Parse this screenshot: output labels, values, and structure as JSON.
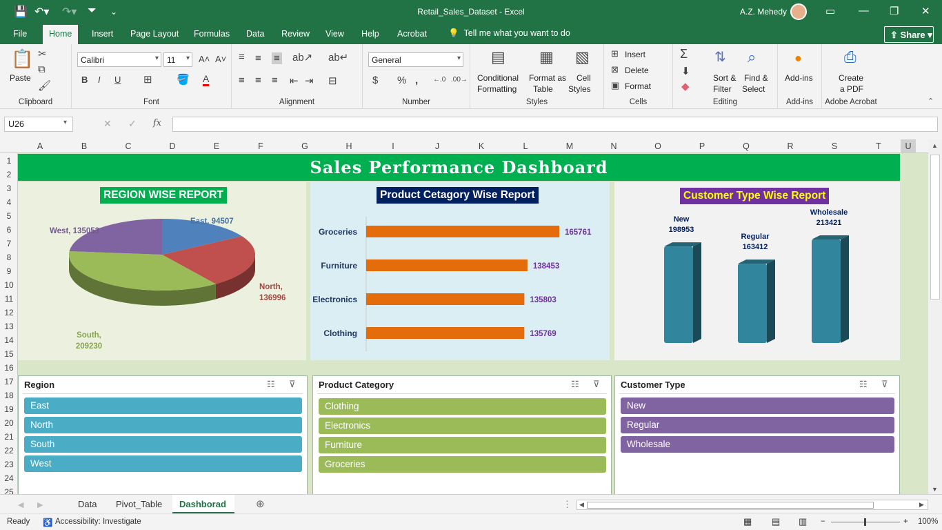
{
  "window": {
    "title": "Retail_Sales_Dataset  -  Excel",
    "user": "A.Z. Mehedy"
  },
  "menu": {
    "tabs": [
      "File",
      "Home",
      "Insert",
      "Page Layout",
      "Formulas",
      "Data",
      "Review",
      "View",
      "Help",
      "Acrobat"
    ],
    "active": "Home",
    "tell_me": "Tell me what you want to do",
    "share": "Share"
  },
  "ribbon": {
    "clipboard": {
      "label": "Clipboard",
      "paste": "Paste"
    },
    "font": {
      "label": "Font",
      "name": "Calibri",
      "size": "11"
    },
    "alignment": {
      "label": "Alignment"
    },
    "number": {
      "label": "Number",
      "format": "General"
    },
    "styles": {
      "label": "Styles",
      "conditional": "Conditional",
      "conditional2": "Formatting",
      "format_table": "Format as",
      "format_table2": "Table",
      "cell_styles": "Cell",
      "cell_styles2": "Styles"
    },
    "cells": {
      "label": "Cells",
      "insert": "Insert",
      "delete": "Delete",
      "format": "Format"
    },
    "editing": {
      "label": "Editing",
      "sort": "Sort &",
      "sort2": "Filter",
      "find": "Find &",
      "find2": "Select"
    },
    "addins": {
      "label": "Add-ins",
      "btn": "Add-ins"
    },
    "acrobat": {
      "label": "Adobe Acrobat",
      "btn": "Create",
      "btn2": "a PDF"
    }
  },
  "formula_bar": {
    "name_box": "U26",
    "fx": "fx",
    "value": ""
  },
  "columns": [
    "A",
    "B",
    "C",
    "D",
    "E",
    "F",
    "G",
    "H",
    "I",
    "J",
    "K",
    "L",
    "M",
    "N",
    "O",
    "P",
    "Q",
    "R",
    "S",
    "T",
    "U"
  ],
  "rows": [
    "1",
    "2",
    "3",
    "4",
    "5",
    "6",
    "7",
    "8",
    "9",
    "10",
    "11",
    "12",
    "13",
    "14",
    "15",
    "16",
    "17",
    "18",
    "19",
    "20",
    "21",
    "22",
    "23",
    "24",
    "25"
  ],
  "dashboard": {
    "title": "Sales Performance Dashboard",
    "region_title": "REGION WISE REPORT",
    "product_title": "Product Cetagory Wise Report",
    "customer_title": "Customer Type Wise Report"
  },
  "chart_data": [
    {
      "type": "pie",
      "title": "REGION WISE REPORT",
      "categories": [
        "East",
        "North",
        "South",
        "West"
      ],
      "values": [
        94507,
        136996,
        209230,
        135053
      ],
      "labels": [
        "East, 94507",
        "North, 136996",
        "South, 209230",
        "West, 135053"
      ],
      "colors": [
        "#4f81bd",
        "#c0504d",
        "#9bbb59",
        "#8064a2"
      ]
    },
    {
      "type": "bar",
      "title": "Product Cetagory Wise Report",
      "categories": [
        "Groceries",
        "Furniture",
        "Electronics",
        "Clothing"
      ],
      "values": [
        165761,
        138453,
        135803,
        135769
      ],
      "color": "#e46c0a",
      "orientation": "horizontal"
    },
    {
      "type": "bar",
      "title": "Customer Type Wise Report",
      "categories": [
        "New",
        "Regular",
        "Wholesale"
      ],
      "values": [
        198953,
        163412,
        213421
      ],
      "color": "#31859c",
      "style": "3d-column"
    }
  ],
  "slicers": [
    {
      "title": "Region",
      "items": [
        "East",
        "North",
        "South",
        "West"
      ],
      "color": "#4bacc6"
    },
    {
      "title": "Product Category",
      "items": [
        "Clothing",
        "Electronics",
        "Furniture",
        "Groceries"
      ],
      "color": "#9bbb59"
    },
    {
      "title": "Customer Type",
      "items": [
        "New",
        "Regular",
        "Wholesale"
      ],
      "color": "#8064a2"
    }
  ],
  "sheet_tabs": [
    "Data",
    "Pivot_Table",
    "Dashborad"
  ],
  "active_sheet": "Dashborad",
  "status": {
    "ready": "Ready",
    "accessibility": "Accessibility: Investigate",
    "zoom": "100%"
  }
}
